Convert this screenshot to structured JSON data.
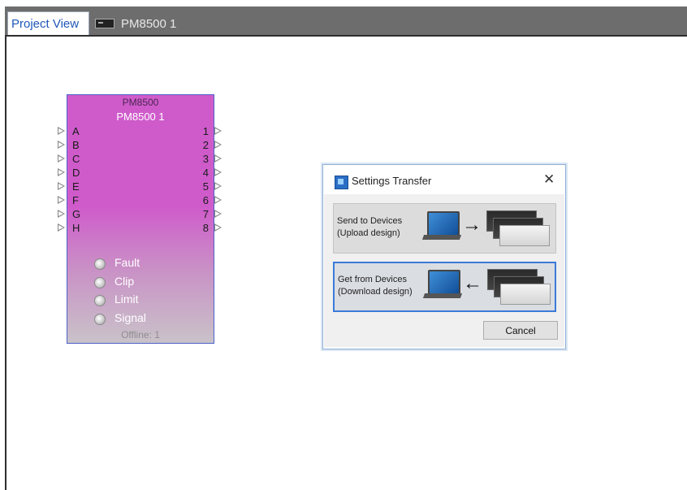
{
  "tabs": [
    {
      "label": "Project View",
      "active": true
    },
    {
      "label": "PM8500 1",
      "active": false,
      "icon": "device-icon"
    }
  ],
  "device": {
    "model": "PM8500",
    "name": "PM8500 1",
    "inputs": [
      "A",
      "B",
      "C",
      "D",
      "E",
      "F",
      "G",
      "H"
    ],
    "outputs": [
      "1",
      "2",
      "3",
      "4",
      "5",
      "6",
      "7",
      "8"
    ],
    "indicators": [
      "Fault",
      "Clip",
      "Limit",
      "Signal"
    ],
    "status": "Offline: 1",
    "color": "#cf5bcb"
  },
  "dialog": {
    "title": "Settings Transfer",
    "close_icon": "close-icon",
    "send": {
      "line1": "Send to Devices",
      "line2": "(Upload design)",
      "arrow": "→"
    },
    "get": {
      "line1": "Get from Devices",
      "line2": "(Download design)",
      "arrow": "←",
      "selected": true
    },
    "cancel_label": "Cancel"
  }
}
